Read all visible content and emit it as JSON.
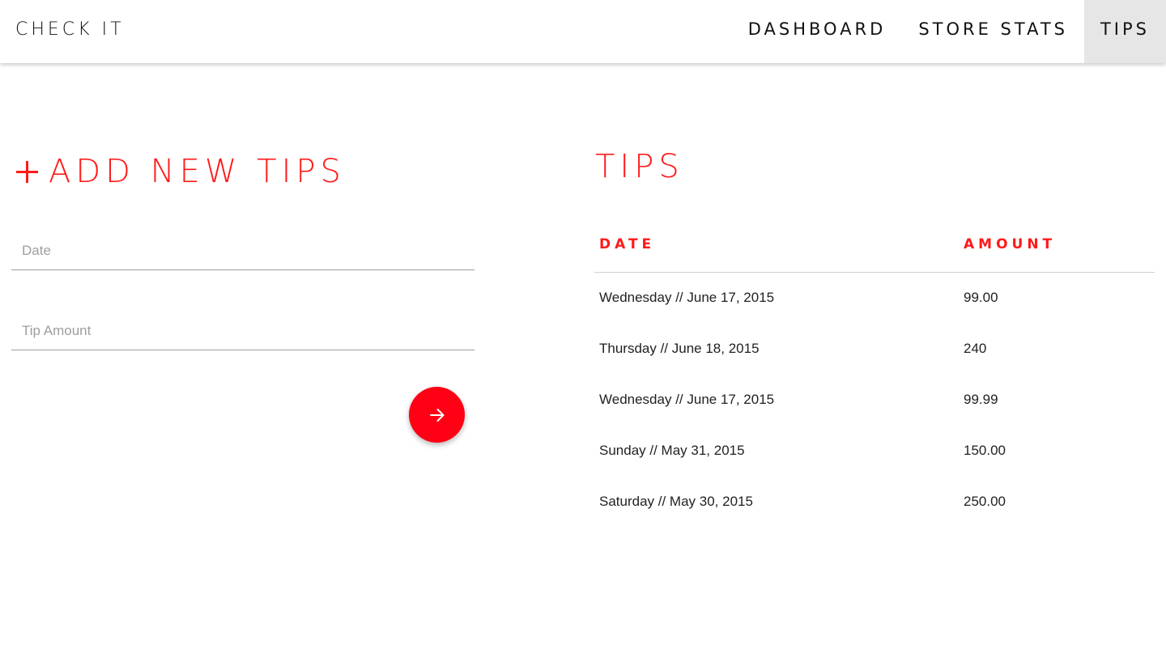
{
  "brand": {
    "label": "CHECK IT"
  },
  "nav": {
    "items": [
      {
        "label": "DASHBOARD"
      },
      {
        "label": "STORE STATS"
      },
      {
        "label": "TIPS"
      }
    ],
    "active": "TIPS"
  },
  "add_tips": {
    "title": "ADD NEW TIPS",
    "icon": "plus-icon",
    "date_placeholder": "Date",
    "amount_placeholder": "Tip Amount",
    "submit_icon": "arrow-right-icon"
  },
  "tips": {
    "title": "TIPS",
    "columns": [
      "DATE",
      "AMOUNT"
    ],
    "rows": [
      {
        "date": "Wednesday // June 17, 2015",
        "amount": "99.00"
      },
      {
        "date": "Thursday // June 18, 2015",
        "amount": "240"
      },
      {
        "date": "Wednesday // June 17, 2015",
        "amount": "99.99"
      },
      {
        "date": "Sunday // May 31, 2015",
        "amount": "150.00"
      },
      {
        "date": "Saturday // May 30, 2015",
        "amount": "250.00"
      }
    ]
  },
  "colors": {
    "accent": "#ff1a1a",
    "active_nav_bg": "#e6e6e6",
    "button": "#ff0014"
  }
}
